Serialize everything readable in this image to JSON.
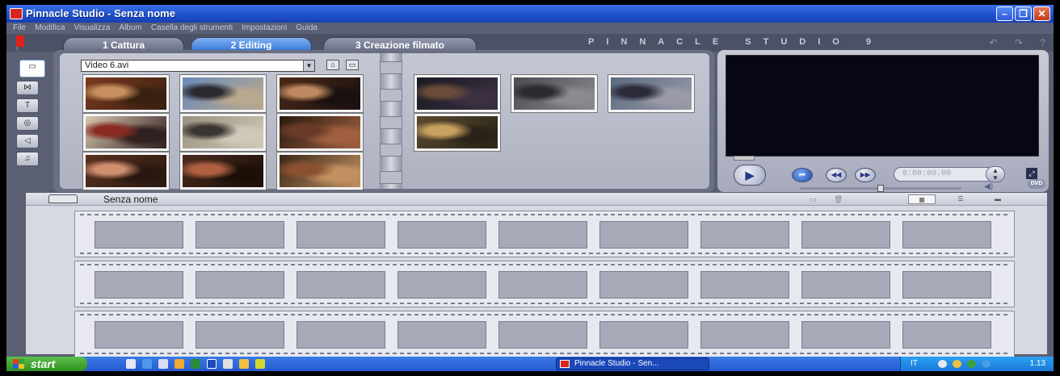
{
  "window": {
    "title": "Pinnacle Studio - Senza nome"
  },
  "menu": [
    "File",
    "Modifica",
    "Visualizza",
    "Album",
    "Casella degli strumenti",
    "Impostazioni",
    "Guida"
  ],
  "tabs": [
    {
      "label": "1 Cattura",
      "active": false
    },
    {
      "label": "2 Editing",
      "active": true
    },
    {
      "label": "3 Creazione filmato",
      "active": false
    }
  ],
  "brand": "PINNACLE STUDIO 9",
  "album": {
    "source_file": "Video 6.avi",
    "left_thumbs": [
      {
        "name": "scene-people-room",
        "colors": [
          "#7a3a20",
          "#c89060",
          "#3a2010"
        ]
      },
      {
        "name": "scene-person-meal",
        "colors": [
          "#6a8ab8",
          "#2a2a30",
          "#b8a890"
        ]
      },
      {
        "name": "scene-closeup-face",
        "colors": [
          "#4a2a18",
          "#c08a60",
          "#1a1010"
        ]
      },
      {
        "name": "scene-newspaper-battista",
        "colors": [
          "#d8c8b0",
          "#8a2a20",
          "#302020"
        ]
      },
      {
        "name": "scene-newspaper-photo",
        "colors": [
          "#9a9080",
          "#3a3530",
          "#d0c8b8"
        ]
      },
      {
        "name": "scene-crowd-table",
        "colors": [
          "#2a1a10",
          "#6a3a28",
          "#a06040"
        ]
      },
      {
        "name": "scene-woman-smiling",
        "colors": [
          "#5a3020",
          "#d09070",
          "#2a1810"
        ]
      },
      {
        "name": "scene-group-dinner",
        "colors": [
          "#4a2a20",
          "#b06040",
          "#1a1008"
        ]
      },
      {
        "name": "scene-party",
        "colors": [
          "#3a2818",
          "#8a5030",
          "#c09060"
        ]
      }
    ],
    "right_thumbs": [
      {
        "name": "scene-dark-room",
        "colors": [
          "#1a1a22",
          "#6a4a38",
          "#3a3040"
        ]
      },
      {
        "name": "scene-crowd-gathering",
        "colors": [
          "#4a4a50",
          "#2a2a30",
          "#8a8a90"
        ]
      },
      {
        "name": "scene-dining-hall",
        "colors": [
          "#5a6a80",
          "#2a2a3a",
          "#9a9aa8"
        ]
      },
      {
        "name": "scene-speaker",
        "colors": [
          "#5a4a30",
          "#c8a060",
          "#2a2418"
        ]
      }
    ]
  },
  "preview": {
    "timecode": "0:00:00.00",
    "fullscreen_icon": "⤢",
    "dvd_label": "DVD"
  },
  "movie": {
    "title": "Senza nome",
    "rows": 3,
    "frames_per_row": 9
  },
  "taskbar": {
    "start_label": "start",
    "task_label": "Pinnacle Studio - Sen...",
    "language": "IT",
    "clock": "1.13"
  },
  "colors": {
    "titlebar": "#1d4fcc",
    "active_tab": "#3a78d8",
    "film_frame": "#a6a9b7"
  }
}
